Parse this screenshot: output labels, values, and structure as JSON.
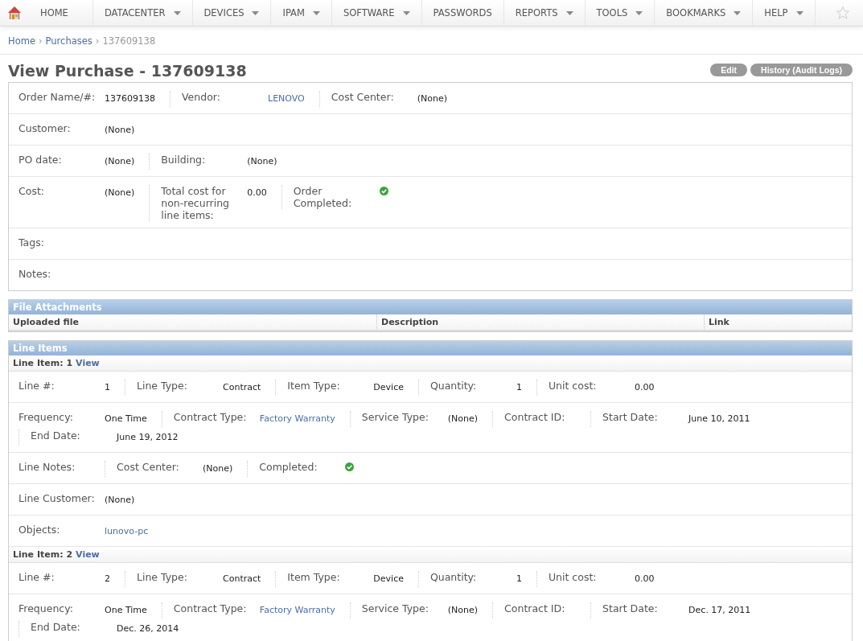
{
  "nav": {
    "items": [
      {
        "label": "HOME",
        "dropdown": false
      },
      {
        "label": "DATACENTER",
        "dropdown": true
      },
      {
        "label": "DEVICES",
        "dropdown": true
      },
      {
        "label": "IPAM",
        "dropdown": true
      },
      {
        "label": "SOFTWARE",
        "dropdown": true
      },
      {
        "label": "PASSWORDS",
        "dropdown": false
      },
      {
        "label": "REPORTS",
        "dropdown": true
      },
      {
        "label": "TOOLS",
        "dropdown": true
      },
      {
        "label": "BOOKMARKS",
        "dropdown": true
      },
      {
        "label": "HELP",
        "dropdown": true
      }
    ]
  },
  "breadcrumb": [
    {
      "label": "Home",
      "kind": "link"
    },
    {
      "label": "›",
      "kind": "separator"
    },
    {
      "label": "Purchases",
      "kind": "link"
    },
    {
      "label": "›",
      "kind": "separator"
    },
    {
      "label": "137609138",
      "kind": "current"
    }
  ],
  "title": "View Purchase - 137609138",
  "buttons": [
    "Edit",
    "History (Audit Logs)"
  ],
  "details": {
    "rows": [
      [
        {
          "label": "Order Name/#:",
          "value": "137609138",
          "kind": "text"
        },
        {
          "label": "Vendor:",
          "value": "LENOVO",
          "kind": "link"
        },
        {
          "label": "Cost Center:",
          "value": "(None)",
          "kind": "text"
        }
      ],
      [
        {
          "label": "Customer:",
          "value": "(None)",
          "kind": "text"
        }
      ],
      [
        {
          "label": "PO date:",
          "value": "(None)",
          "kind": "text"
        },
        {
          "label": "Building:",
          "value": "(None)",
          "kind": "text"
        }
      ],
      [
        {
          "label": "Cost:",
          "value": "(None)",
          "kind": "text"
        },
        {
          "label": "Total cost for non-recurring line items:",
          "value": "0.00",
          "kind": "text"
        },
        {
          "label": "Order Completed:",
          "kind": "check",
          "checked": true
        }
      ],
      [
        {
          "label": "Tags:",
          "kind": "empty"
        }
      ],
      [
        {
          "label": "Notes:",
          "kind": "empty"
        }
      ]
    ]
  },
  "attachments": {
    "title": "File Attachments",
    "columns": [
      "Uploaded file",
      "Description",
      "Link"
    ]
  },
  "line_items": {
    "title": "Line Items",
    "items": [
      {
        "heading": "Line Item: 1",
        "link": "View",
        "rows": [
          [
            {
              "label": "Line #:",
              "value": "1",
              "kind": "text"
            },
            {
              "label": "Line Type:",
              "value": "Contract",
              "kind": "text"
            },
            {
              "label": "Item Type:",
              "value": "Device",
              "kind": "text"
            },
            {
              "label": "Quantity:",
              "value": "1",
              "kind": "text"
            },
            {
              "label": "Unit cost:",
              "value": "0.00",
              "kind": "text"
            }
          ],
          [
            {
              "label": "Frequency:",
              "value": "One Time",
              "kind": "text"
            },
            {
              "label": "Contract Type:",
              "value": "Factory Warranty",
              "kind": "link"
            },
            {
              "label": "Service Type:",
              "value": "(None)",
              "kind": "text"
            },
            {
              "label": "Contract ID:",
              "kind": "empty"
            },
            {
              "label": "Start Date:",
              "value": "June 10, 2011",
              "kind": "text"
            },
            {
              "label": "End Date:",
              "value": "June 19, 2012",
              "kind": "text"
            }
          ],
          [
            {
              "label": "Line Notes:",
              "kind": "empty"
            },
            {
              "label": "Cost Center:",
              "value": "(None)",
              "kind": "text"
            },
            {
              "label": "Completed:",
              "kind": "check",
              "checked": true
            }
          ],
          [
            {
              "label": "Line Customer:",
              "value": "(None)",
              "kind": "text"
            }
          ],
          [
            {
              "label": "Objects:",
              "value": "lunovo-pc",
              "kind": "link"
            }
          ]
        ]
      },
      {
        "heading": "Line Item: 2",
        "link": "View",
        "rows": [
          [
            {
              "label": "Line #:",
              "value": "2",
              "kind": "text"
            },
            {
              "label": "Line Type:",
              "value": "Contract",
              "kind": "text"
            },
            {
              "label": "Item Type:",
              "value": "Device",
              "kind": "text"
            },
            {
              "label": "Quantity:",
              "value": "1",
              "kind": "text"
            },
            {
              "label": "Unit cost:",
              "value": "0.00",
              "kind": "text"
            }
          ],
          [
            {
              "label": "Frequency:",
              "value": "One Time",
              "kind": "text"
            },
            {
              "label": "Contract Type:",
              "value": "Factory Warranty",
              "kind": "link"
            },
            {
              "label": "Service Type:",
              "value": "(None)",
              "kind": "text"
            },
            {
              "label": "Contract ID:",
              "kind": "empty"
            },
            {
              "label": "Start Date:",
              "value": "Dec. 17, 2011",
              "kind": "text"
            },
            {
              "label": "End Date:",
              "value": "Dec. 26, 2014",
              "kind": "text"
            }
          ]
        ]
      }
    ]
  }
}
